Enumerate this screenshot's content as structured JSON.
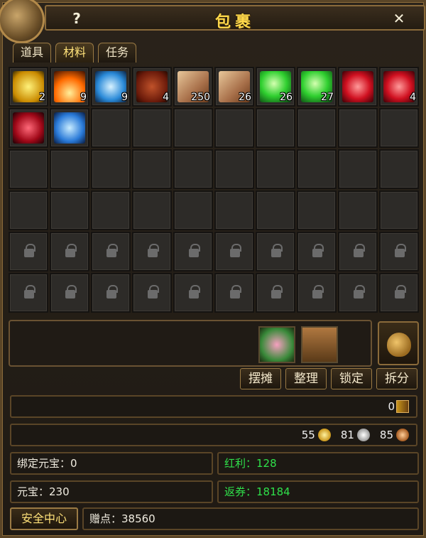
{
  "window": {
    "title": "包裹",
    "help_label": "?",
    "close_label": "✕"
  },
  "tabs": [
    {
      "label": "道具",
      "active": false
    },
    {
      "label": "材料",
      "active": true
    },
    {
      "label": "任务",
      "active": false
    }
  ],
  "inventory": {
    "items": [
      {
        "icon": "yellow-crystal-icon",
        "count": "2"
      },
      {
        "icon": "flame-essence-icon",
        "count": "9"
      },
      {
        "icon": "blue-crystal-icon",
        "count": "9"
      },
      {
        "icon": "talisman-icon",
        "count": "4"
      },
      {
        "icon": "scroll-icon",
        "count": "250"
      },
      {
        "icon": "scroll-icon",
        "count": "26"
      },
      {
        "icon": "green-orb-icon",
        "count": "26"
      },
      {
        "icon": "green-orb-icon",
        "count": "27"
      },
      {
        "icon": "ruby-icon",
        "count": ""
      },
      {
        "icon": "ruby-icon",
        "count": "4"
      },
      {
        "icon": "red-gem-icon",
        "count": ""
      },
      {
        "icon": "sapphire-icon",
        "count": ""
      }
    ],
    "empty_slots": 28,
    "locked_slots": 20
  },
  "tray": {
    "items": [
      {
        "icon": "pouch-icon"
      },
      {
        "icon": "treasure-chest-icon"
      }
    ],
    "bag_button_icon": "money-bag-icon"
  },
  "actions": {
    "stall": "摆摊",
    "sort": "整理",
    "lock": "锁定",
    "split": "拆分"
  },
  "bars": {
    "book_count": "0",
    "gold_coins": "55",
    "silver_coins": "81",
    "copper_coins": "85"
  },
  "info": {
    "bound_yuanbao": "绑定元宝：0",
    "dividend": "红利：128",
    "yuanbao": "元宝：230",
    "voucher": "返券：18184",
    "gift_points": "赠点：38560",
    "safety_center": "安全中心"
  },
  "colors": {
    "title": "#ffd84a",
    "green_text": "#2fe04a",
    "frame_border": "#8a6a3a"
  }
}
